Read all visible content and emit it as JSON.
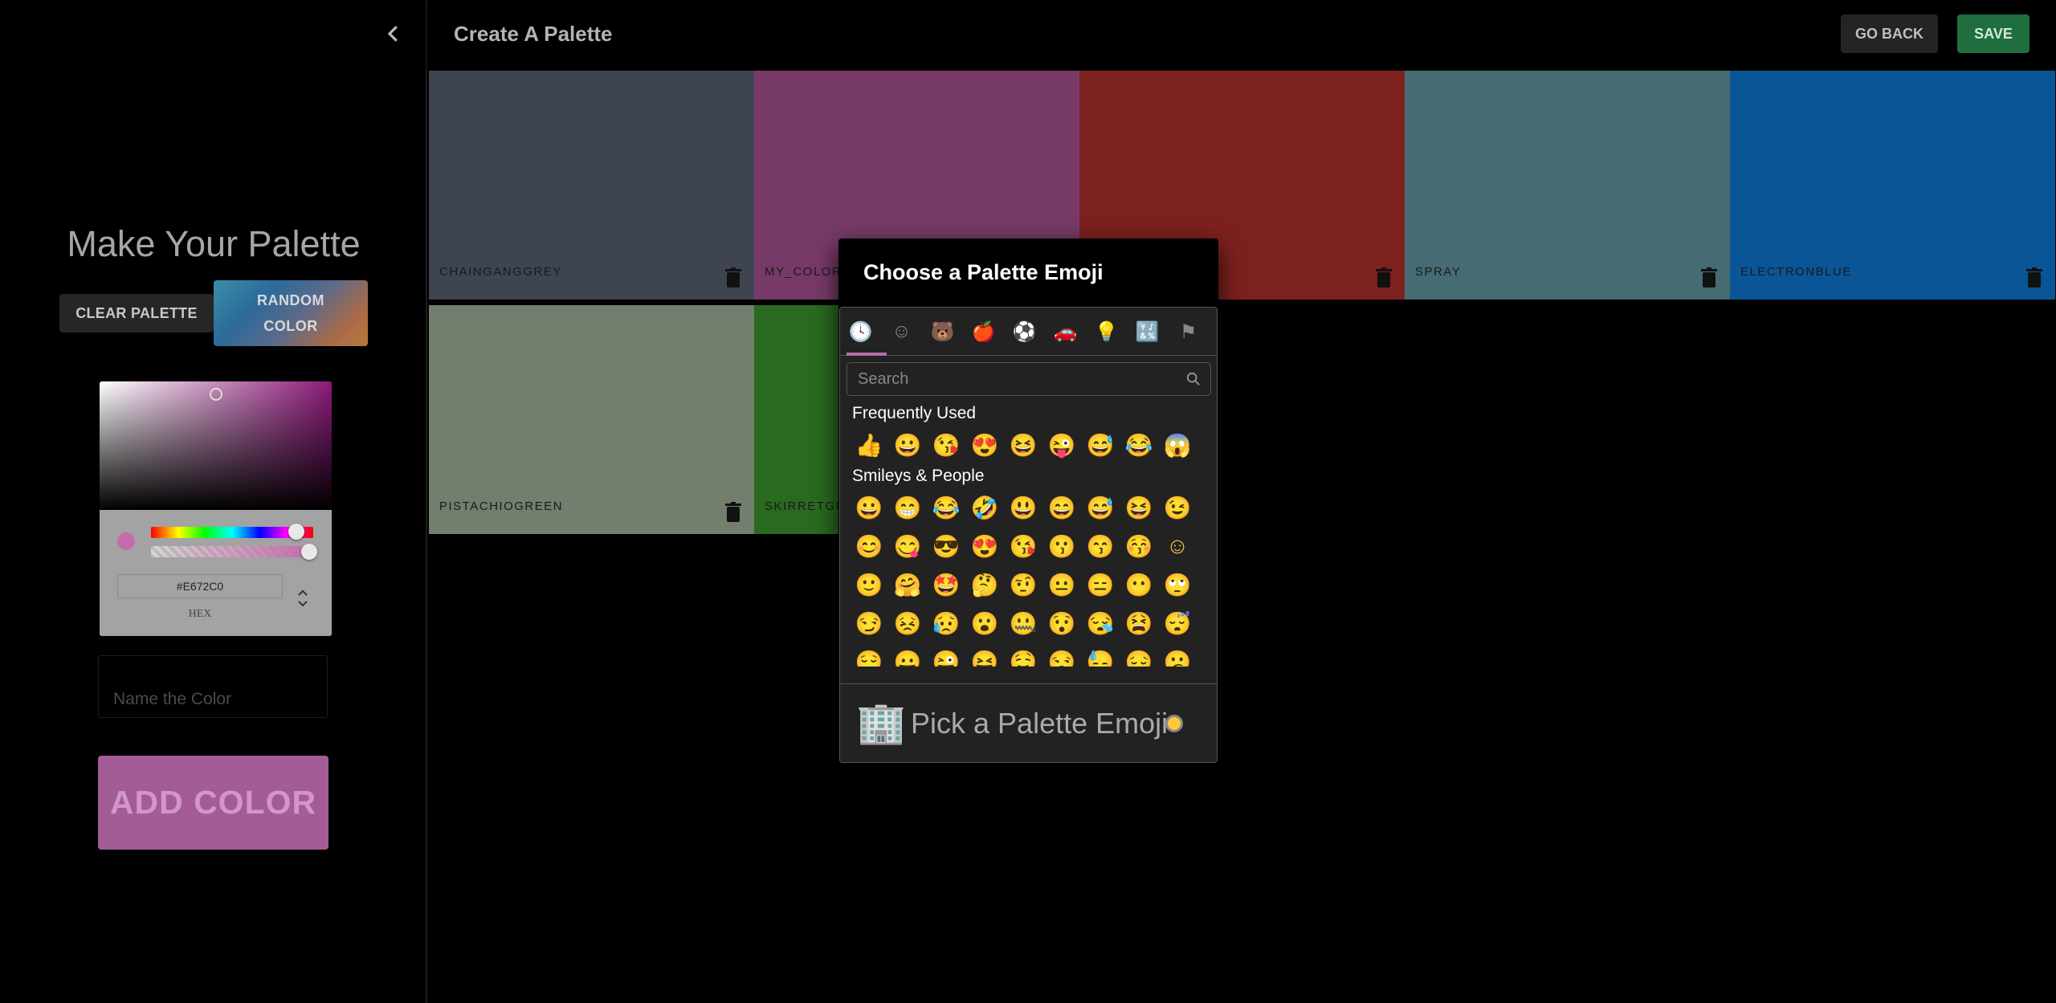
{
  "appbar": {
    "title": "Create A Palette",
    "go_back_label": "GO BACK",
    "save_label": "SAVE"
  },
  "drawer": {
    "title": "Make Your Palette",
    "clear_label": "CLEAR PALETTE",
    "random_label": "RANDOM COLOR",
    "picker": {
      "hex_value": "#E672C0",
      "hex_label": "HEX",
      "toggle_glyph": "⌃⌄"
    },
    "name_placeholder": "Name the Color",
    "add_label": "ADD COLOR",
    "collapse_icon": "chevron-left-icon"
  },
  "palette": [
    {
      "name": "CHAINGANGGREY",
      "color": "#3e4450"
    },
    {
      "name": "MY_COLOR",
      "color": "#773a68"
    },
    {
      "name": "",
      "color": "#7d211e"
    },
    {
      "name": "SPRAY",
      "color": "#466b72"
    },
    {
      "name": "ELECTRONBLUE",
      "color": "#0a5596"
    },
    {
      "name": "PISTACHIOGREEN",
      "color": "#727e6e"
    },
    {
      "name": "SKIRRETGR",
      "color": "#2a6a20"
    }
  ],
  "emoji_dialog": {
    "title": "Choose a Palette Emoji",
    "search_placeholder": "Search",
    "categories": [
      "clock-icon",
      "smiley-icon",
      "animal-icon",
      "food-icon",
      "sport-icon",
      "car-icon",
      "bulb-icon",
      "symbols-icon",
      "flag-icon"
    ],
    "category_glyphs": [
      "🕓",
      "☺",
      "🐻",
      "🍎",
      "⚽",
      "🚗",
      "💡",
      "🔣",
      "⚑"
    ],
    "sections": [
      {
        "label": "Frequently Used",
        "rows": [
          [
            "👍",
            "😀",
            "😘",
            "😍",
            "😆",
            "😜",
            "😅",
            "😂",
            "😱"
          ]
        ]
      },
      {
        "label": "Smileys & People",
        "rows": [
          [
            "😀",
            "😁",
            "😂",
            "🤣",
            "😃",
            "😄",
            "😅",
            "😆",
            "😉"
          ],
          [
            "😊",
            "😋",
            "😎",
            "😍",
            "😘",
            "😗",
            "😙",
            "😚",
            "☺"
          ],
          [
            "🙂",
            "🤗",
            "🤩",
            "🤔",
            "🤨",
            "😐",
            "😑",
            "😶",
            "🙄"
          ],
          [
            "😏",
            "😣",
            "😥",
            "😮",
            "🤐",
            "😯",
            "😪",
            "😫",
            "😴"
          ],
          [
            "😌",
            "😛",
            "😜",
            "😝",
            "🤤",
            "😒",
            "😓",
            "😔",
            "😕"
          ]
        ]
      }
    ],
    "preview_emoji": "🏢",
    "preview_text": "Pick a Palette Emoji"
  },
  "colors": {
    "accent": "#b370a8",
    "save_green": "#1f6e3e"
  }
}
